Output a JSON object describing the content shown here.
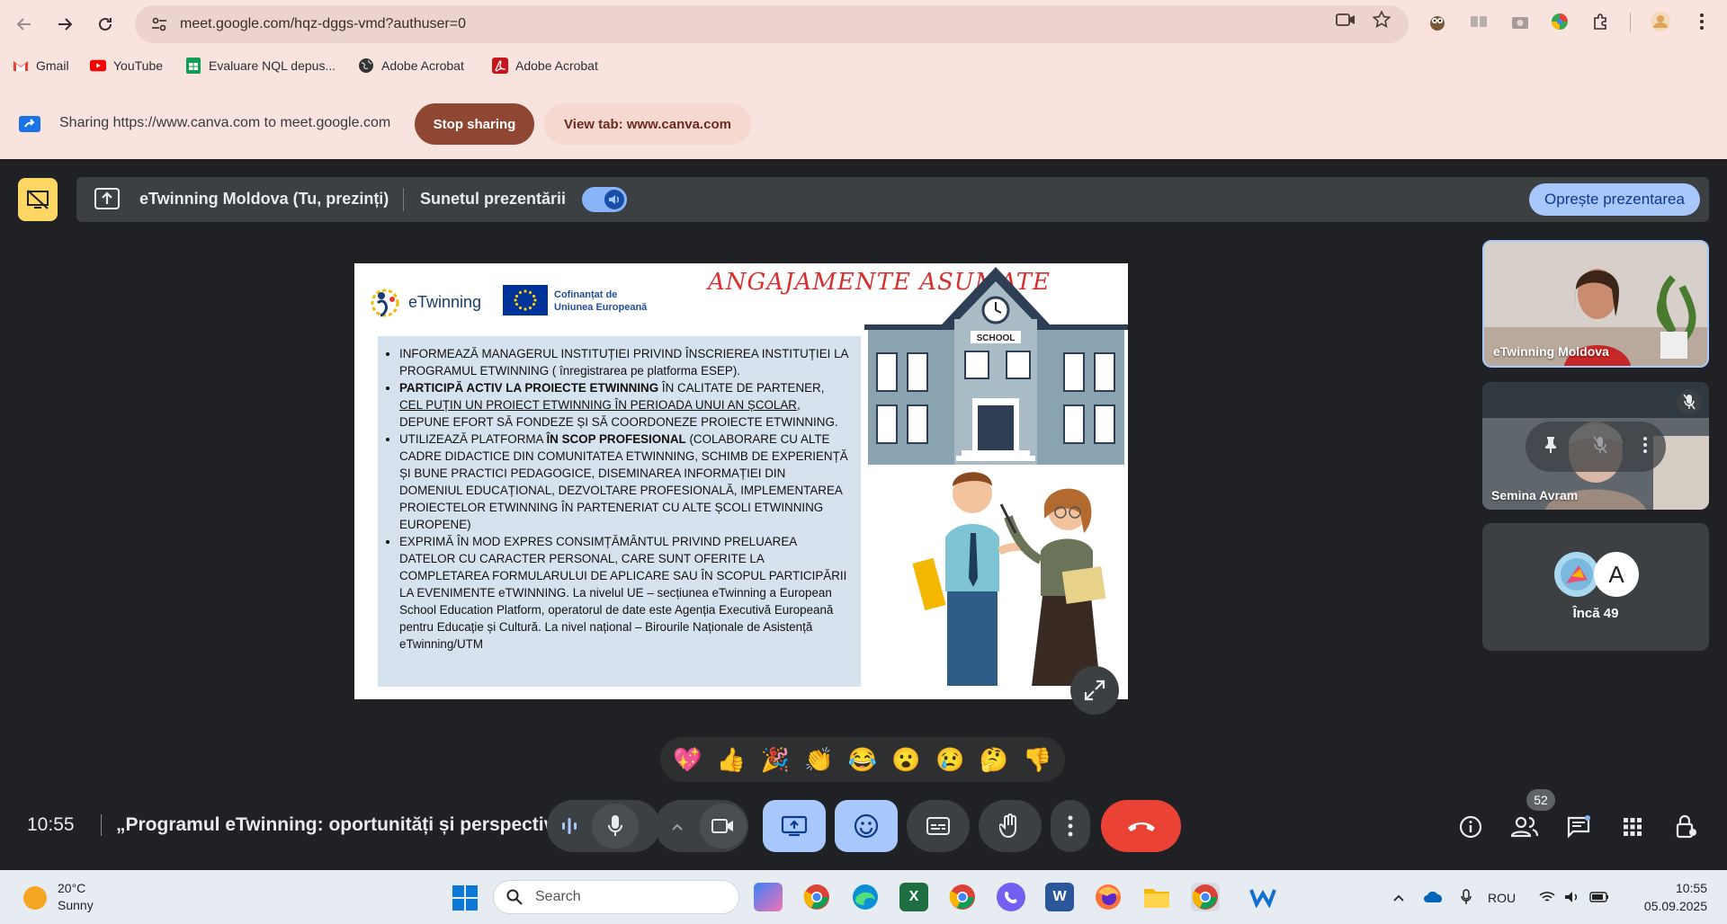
{
  "browser": {
    "url": "meet.google.com/hqz-dggs-vmd?authuser=0",
    "bookmarks": [
      {
        "label": "Gmail",
        "icon": "gmail-icon"
      },
      {
        "label": "YouTube",
        "icon": "youtube-icon"
      },
      {
        "label": "Evaluare NQL depus...",
        "icon": "sheets-icon"
      },
      {
        "label": "Adobe Acrobat",
        "icon": "globe-icon"
      },
      {
        "label": "Adobe Acrobat",
        "icon": "acrobat-icon"
      }
    ],
    "share_text": "Sharing https://www.canva.com to meet.google.com",
    "stop_sharing": "Stop sharing",
    "view_tab": "View tab: www.canva.com"
  },
  "meet": {
    "presenter_label": "eTwinning Moldova (Tu, prezinți)",
    "audio_label": "Sunetul prezentării",
    "audio_on": true,
    "stop_present": "Oprește prezentarea",
    "clock": "10:55",
    "meeting_title": "„Programul eTwinning: oportunități și perspectiv...",
    "people_count": "52",
    "reactions": [
      "💖",
      "👍",
      "🎉",
      "👏",
      "😂",
      "😮",
      "😢",
      "🤔",
      "👎"
    ]
  },
  "slide": {
    "logo_text": "eTwinning",
    "eu_line1": "Cofinanțat de",
    "eu_line2": "Uniunea Europeană",
    "title": "ANGAJAMENTE ASUMATE",
    "school_sign": "SCHOOL",
    "bullets": {
      "b1": "INFORMEAZĂ MANAGERUL INSTITUȚIEI PRIVIND ÎNSCRIEREA INSTITUȚIEI LA PROGRAMUL ETWINNING ( înregistrarea pe platforma ESEP).",
      "b2_bold": "PARTICIPĂ ACTIV LA PROIECTE ETWINNING",
      "b2_rest": " ÎN CALITATE DE PARTENER,",
      "b2_underline": "CEL PUȚIN UN PROIECT ETWINNING ÎN PERIOADA UNUI AN ȘCOLAR",
      "b2_end": ", DEPUNE EFORT SĂ FONDEZE ȘI SĂ COORDONEZE PROIECTE ETWINNING.",
      "b3_start": "UTILIZEAZĂ PLATFORMA ",
      "b3_bold": "ÎN SCOP PROFESIONAL",
      "b3_end": " (COLABORARE CU ALTE CADRE DIDACTICE DIN COMUNITATEA ETWINNING, SCHIMB DE EXPERIENȚĂ ȘI BUNE PRACTICI PEDAGOGICE, DISEMINAREA INFORMAȚIEI DIN DOMENIUL EDUCAȚIONAL, DEZVOLTARE PROFESIONALĂ, IMPLEMENTAREA PROIECTELOR ETWINNING ÎN PARTENERIAT CU ALTE ȘCOLI ETWINNING EUROPENE)",
      "b4": "EXPRIMĂ ÎN MOD EXPRES CONSIMȚĂMÂNTUL PRIVIND PRELUAREA DATELOR CU CARACTER PERSONAL, CARE SUNT OFERITE LA COMPLETAREA FORMULARULUI DE APLICARE SAU ÎN SCOPUL PARTICIPĂRII LA EVENIMENTE eTWINNING. La nivelul UE – secțiunea eTwinning a European School Education Platform,  operatorul de date este Agenția Executivă Europeană pentru Educație și Cultură. La nivel național – Birourile Naționale de Asistență eTwinning/UTM"
    }
  },
  "participants": {
    "tile1_name": "eTwinning Moldova",
    "tile2_name": "Semina Avram",
    "more_avatar_letter": "A",
    "more_label": "Încă 49"
  },
  "taskbar": {
    "temp": "20°C",
    "weather": "Sunny",
    "search_placeholder": "Search",
    "language": "ROU",
    "time": "10:55",
    "date": "05.09.2025"
  }
}
